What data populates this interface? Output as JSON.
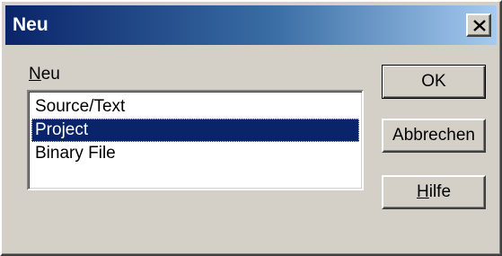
{
  "window": {
    "title": "Neu",
    "close_glyph": "✕"
  },
  "group": {
    "label_accel": "N",
    "label_rest": "eu"
  },
  "list": {
    "items": [
      "Source/Text",
      "Project",
      "Binary File"
    ],
    "selected_index": 1
  },
  "buttons": {
    "ok": "OK",
    "cancel": "Abbrechen",
    "help_accel": "H",
    "help_rest": "ilfe"
  },
  "colors": {
    "face": "#d4d0c8",
    "title_start": "#0a246a",
    "title_end": "#a6caf0",
    "selection": "#0a246a"
  }
}
